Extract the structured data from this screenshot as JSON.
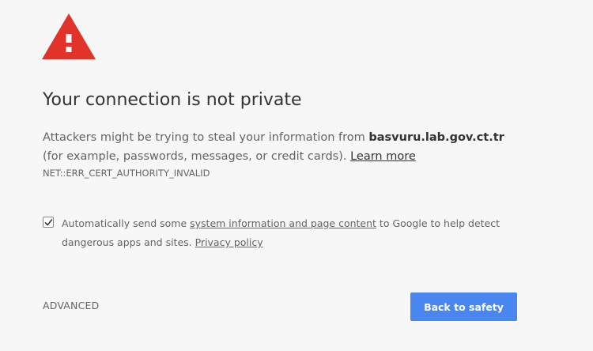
{
  "icon": {
    "name": "warning-triangle-icon",
    "color": "#e2332a",
    "glyph_color": "#ffffff"
  },
  "heading": "Your connection is not private",
  "body": {
    "line1_prefix": "Attackers might be trying to steal your information from ",
    "domain": "basvuru.lab.gov.ct.tr",
    "line2_prefix": "(for example, passwords, messages, or credit cards). ",
    "learn_more": "Learn more"
  },
  "error_code": "NET::ERR_CERT_AUTHORITY_INVALID",
  "report": {
    "checked": true,
    "prefix": "Automatically send some ",
    "link": "system information and page content",
    "suffix": " to Google to help detect",
    "line2_prefix": "dangerous apps and sites. ",
    "privacy_link": "Privacy policy"
  },
  "advanced_label": "ADVANCED",
  "back_button_label": "Back to safety",
  "colors": {
    "background": "#f7f7f7",
    "primary_button": "#4a86f0",
    "text": "#646464",
    "heading": "#333333"
  }
}
